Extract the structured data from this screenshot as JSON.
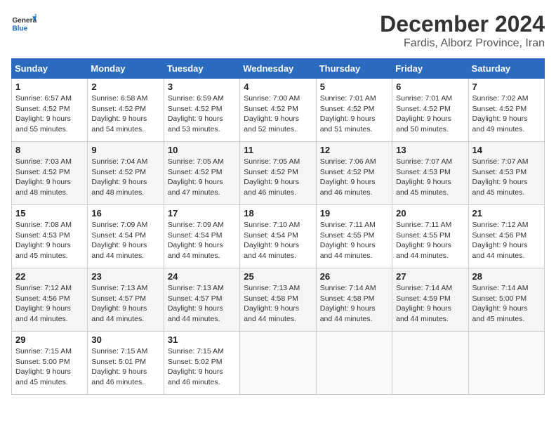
{
  "header": {
    "logo_text_general": "General",
    "logo_text_blue": "Blue",
    "month": "December 2024",
    "location": "Fardis, Alborz Province, Iran"
  },
  "weekdays": [
    "Sunday",
    "Monday",
    "Tuesday",
    "Wednesday",
    "Thursday",
    "Friday",
    "Saturday"
  ],
  "weeks": [
    [
      {
        "day": "1",
        "sunrise": "6:57 AM",
        "sunset": "4:52 PM",
        "daylight": "9 hours and 55 minutes."
      },
      {
        "day": "2",
        "sunrise": "6:58 AM",
        "sunset": "4:52 PM",
        "daylight": "9 hours and 54 minutes."
      },
      {
        "day": "3",
        "sunrise": "6:59 AM",
        "sunset": "4:52 PM",
        "daylight": "9 hours and 53 minutes."
      },
      {
        "day": "4",
        "sunrise": "7:00 AM",
        "sunset": "4:52 PM",
        "daylight": "9 hours and 52 minutes."
      },
      {
        "day": "5",
        "sunrise": "7:01 AM",
        "sunset": "4:52 PM",
        "daylight": "9 hours and 51 minutes."
      },
      {
        "day": "6",
        "sunrise": "7:01 AM",
        "sunset": "4:52 PM",
        "daylight": "9 hours and 50 minutes."
      },
      {
        "day": "7",
        "sunrise": "7:02 AM",
        "sunset": "4:52 PM",
        "daylight": "9 hours and 49 minutes."
      }
    ],
    [
      {
        "day": "8",
        "sunrise": "7:03 AM",
        "sunset": "4:52 PM",
        "daylight": "9 hours and 48 minutes."
      },
      {
        "day": "9",
        "sunrise": "7:04 AM",
        "sunset": "4:52 PM",
        "daylight": "9 hours and 48 minutes."
      },
      {
        "day": "10",
        "sunrise": "7:05 AM",
        "sunset": "4:52 PM",
        "daylight": "9 hours and 47 minutes."
      },
      {
        "day": "11",
        "sunrise": "7:05 AM",
        "sunset": "4:52 PM",
        "daylight": "9 hours and 46 minutes."
      },
      {
        "day": "12",
        "sunrise": "7:06 AM",
        "sunset": "4:52 PM",
        "daylight": "9 hours and 46 minutes."
      },
      {
        "day": "13",
        "sunrise": "7:07 AM",
        "sunset": "4:53 PM",
        "daylight": "9 hours and 45 minutes."
      },
      {
        "day": "14",
        "sunrise": "7:07 AM",
        "sunset": "4:53 PM",
        "daylight": "9 hours and 45 minutes."
      }
    ],
    [
      {
        "day": "15",
        "sunrise": "7:08 AM",
        "sunset": "4:53 PM",
        "daylight": "9 hours and 45 minutes."
      },
      {
        "day": "16",
        "sunrise": "7:09 AM",
        "sunset": "4:54 PM",
        "daylight": "9 hours and 44 minutes."
      },
      {
        "day": "17",
        "sunrise": "7:09 AM",
        "sunset": "4:54 PM",
        "daylight": "9 hours and 44 minutes."
      },
      {
        "day": "18",
        "sunrise": "7:10 AM",
        "sunset": "4:54 PM",
        "daylight": "9 hours and 44 minutes."
      },
      {
        "day": "19",
        "sunrise": "7:11 AM",
        "sunset": "4:55 PM",
        "daylight": "9 hours and 44 minutes."
      },
      {
        "day": "20",
        "sunrise": "7:11 AM",
        "sunset": "4:55 PM",
        "daylight": "9 hours and 44 minutes."
      },
      {
        "day": "21",
        "sunrise": "7:12 AM",
        "sunset": "4:56 PM",
        "daylight": "9 hours and 44 minutes."
      }
    ],
    [
      {
        "day": "22",
        "sunrise": "7:12 AM",
        "sunset": "4:56 PM",
        "daylight": "9 hours and 44 minutes."
      },
      {
        "day": "23",
        "sunrise": "7:13 AM",
        "sunset": "4:57 PM",
        "daylight": "9 hours and 44 minutes."
      },
      {
        "day": "24",
        "sunrise": "7:13 AM",
        "sunset": "4:57 PM",
        "daylight": "9 hours and 44 minutes."
      },
      {
        "day": "25",
        "sunrise": "7:13 AM",
        "sunset": "4:58 PM",
        "daylight": "9 hours and 44 minutes."
      },
      {
        "day": "26",
        "sunrise": "7:14 AM",
        "sunset": "4:58 PM",
        "daylight": "9 hours and 44 minutes."
      },
      {
        "day": "27",
        "sunrise": "7:14 AM",
        "sunset": "4:59 PM",
        "daylight": "9 hours and 44 minutes."
      },
      {
        "day": "28",
        "sunrise": "7:14 AM",
        "sunset": "5:00 PM",
        "daylight": "9 hours and 45 minutes."
      }
    ],
    [
      {
        "day": "29",
        "sunrise": "7:15 AM",
        "sunset": "5:00 PM",
        "daylight": "9 hours and 45 minutes."
      },
      {
        "day": "30",
        "sunrise": "7:15 AM",
        "sunset": "5:01 PM",
        "daylight": "9 hours and 46 minutes."
      },
      {
        "day": "31",
        "sunrise": "7:15 AM",
        "sunset": "5:02 PM",
        "daylight": "9 hours and 46 minutes."
      },
      null,
      null,
      null,
      null
    ]
  ],
  "labels": {
    "sunrise": "Sunrise:",
    "sunset": "Sunset:",
    "daylight": "Daylight:"
  }
}
